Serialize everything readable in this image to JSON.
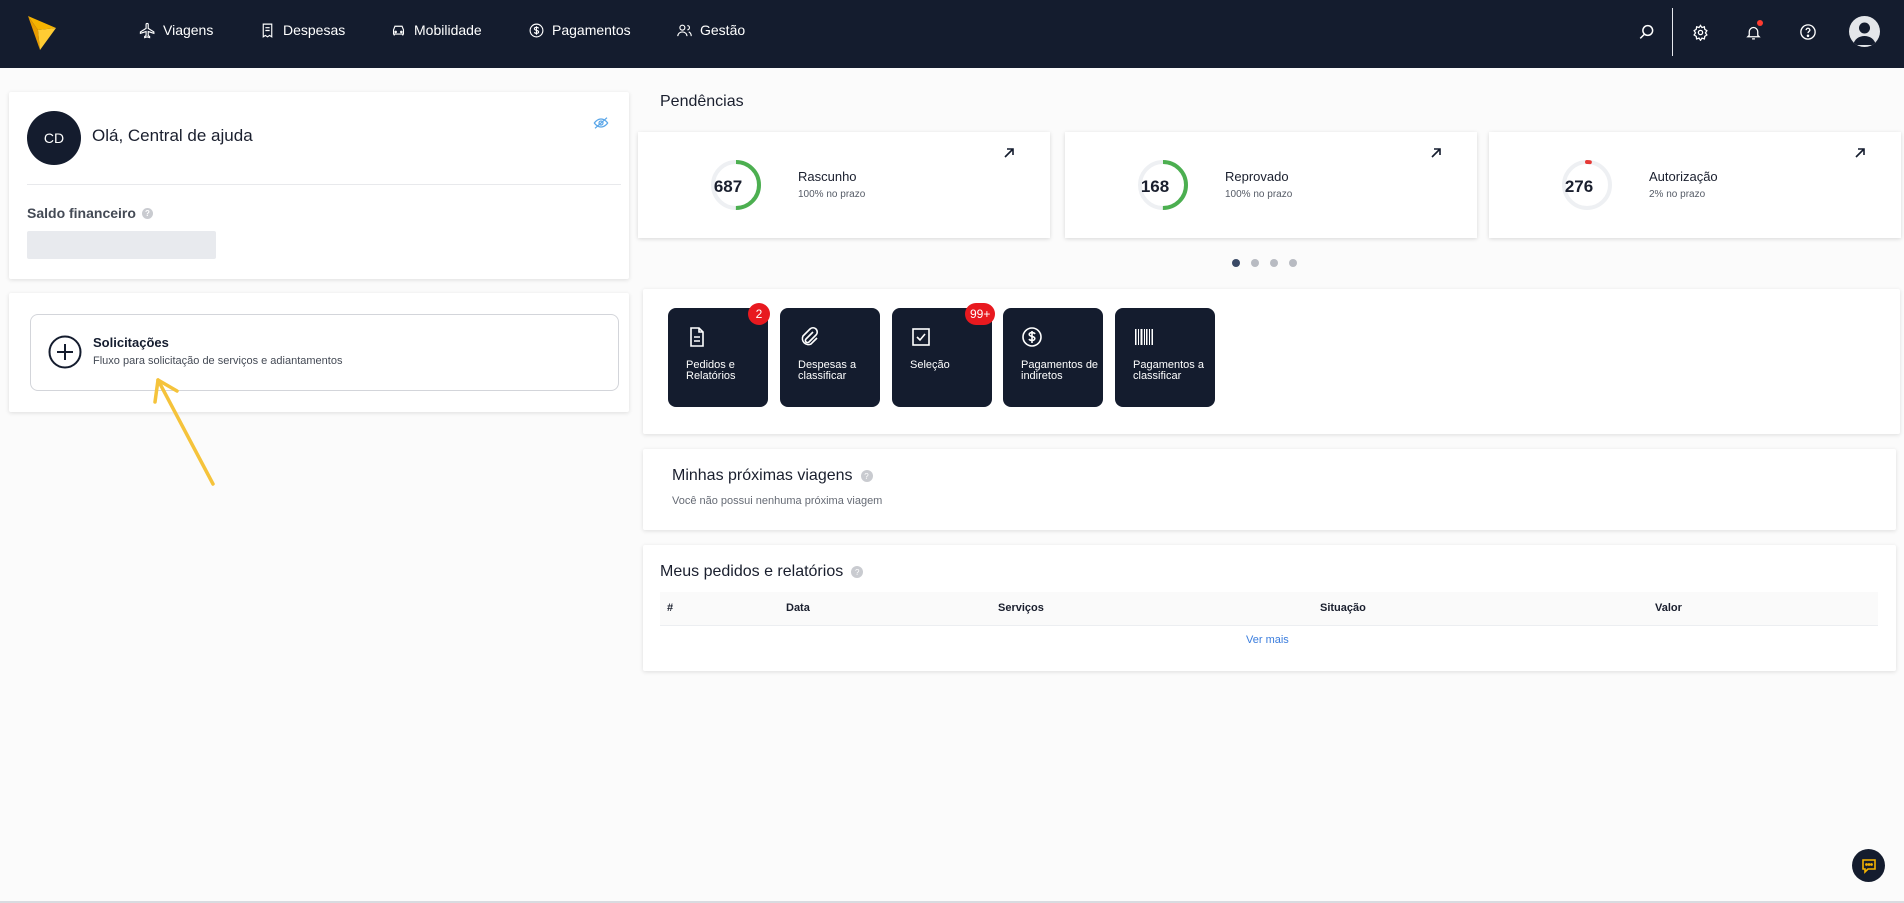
{
  "nav": {
    "items": [
      {
        "label": "Viagens",
        "icon": "plane-icon"
      },
      {
        "label": "Despesas",
        "icon": "receipt-icon"
      },
      {
        "label": "Mobilidade",
        "icon": "car-icon"
      },
      {
        "label": "Pagamentos",
        "icon": "dollar-icon"
      },
      {
        "label": "Gestão",
        "icon": "users-icon"
      }
    ],
    "right_icons": [
      "search-icon",
      "gear-icon",
      "bell-icon",
      "help-icon",
      "user-avatar-icon"
    ]
  },
  "profile": {
    "initials": "CD",
    "greeting": "Olá, Central de ajuda",
    "balance_label": "Saldo financeiro"
  },
  "request": {
    "title": "Solicitações",
    "subtitle": "Fluxo para solicitação de serviços e adiantamentos"
  },
  "pending": {
    "title": "Pendências",
    "cards": [
      {
        "count": "687",
        "label": "Rascunho",
        "sub": "100% no prazo",
        "progress": 1.0,
        "color": "#4caf50"
      },
      {
        "count": "168",
        "label": "Reprovado",
        "sub": "100% no prazo",
        "progress": 1.0,
        "color": "#4caf50"
      },
      {
        "count": "276",
        "label": "Autorização",
        "sub": "2% no prazo",
        "progress": 0.02,
        "color": "#e53935"
      }
    ],
    "pages": 4,
    "active_page": 1
  },
  "shortcuts": [
    {
      "label": "Pedidos e Relatórios",
      "icon": "document-icon",
      "badge": "2"
    },
    {
      "label": "Despesas a classificar",
      "icon": "paperclip-icon",
      "badge": ""
    },
    {
      "label": "Seleção",
      "icon": "checkbox-icon",
      "badge": "99+"
    },
    {
      "label": "Pagamentos de indiretos",
      "icon": "dollar-circle-icon",
      "badge": ""
    },
    {
      "label": "Pagamentos a classificar",
      "icon": "barcode-icon",
      "badge": ""
    }
  ],
  "trips": {
    "title": "Minhas próximas viagens",
    "empty": "Você não possui nenhuma próxima viagem"
  },
  "orders": {
    "title": "Meus pedidos e relatórios",
    "columns": [
      "#",
      "Data",
      "Serviços",
      "Situação",
      "Valor"
    ],
    "more": "Ver mais"
  },
  "colors": {
    "navy": "#141c2e",
    "brand_yellow": "#f5b301",
    "badge_red": "#e8191f",
    "link_blue": "#3b7ddd"
  }
}
